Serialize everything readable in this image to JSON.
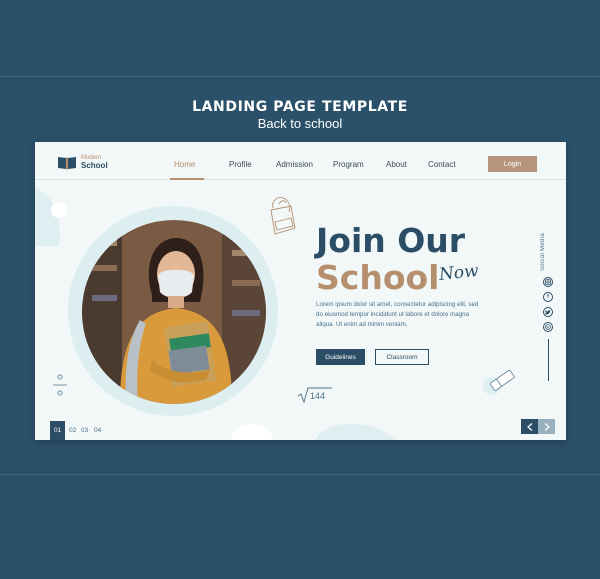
{
  "heading": {
    "title": "LANDING PAGE TEMPLATE",
    "subtitle": "Back to school"
  },
  "logo": {
    "line1": "Modern",
    "line2": "School",
    "icon": "book-icon"
  },
  "nav": {
    "items": [
      {
        "label": "Home",
        "active": true
      },
      {
        "label": "Profile",
        "active": false
      },
      {
        "label": "Admission",
        "active": false
      },
      {
        "label": "Program",
        "active": false
      },
      {
        "label": "About",
        "active": false
      },
      {
        "label": "Contact",
        "active": false
      }
    ],
    "login_label": "Login"
  },
  "hero": {
    "title_line1": "Join Our",
    "title_line2": "School",
    "title_script": "Now",
    "body": "Lorem ipsum dolor sit amet, consectetur adipiscing elit, sed do eiusmod tempor incididunt ut labore et dolore magna aliqua. Ut enim ad minim veniam,",
    "primary_button": "Guidelines",
    "secondary_button": "Classroom",
    "math_doodle": "144"
  },
  "social": {
    "label": "Social Media",
    "icons": [
      "instagram-icon",
      "facebook-icon",
      "twitter-icon",
      "whatsapp-icon"
    ]
  },
  "pager": {
    "pages": [
      "01",
      "02",
      "03",
      "04"
    ],
    "active": "01"
  },
  "colors": {
    "background": "#2b5069",
    "navy": "#2b4e66",
    "tan": "#b68f6e",
    "card": "#f2f8f8"
  }
}
